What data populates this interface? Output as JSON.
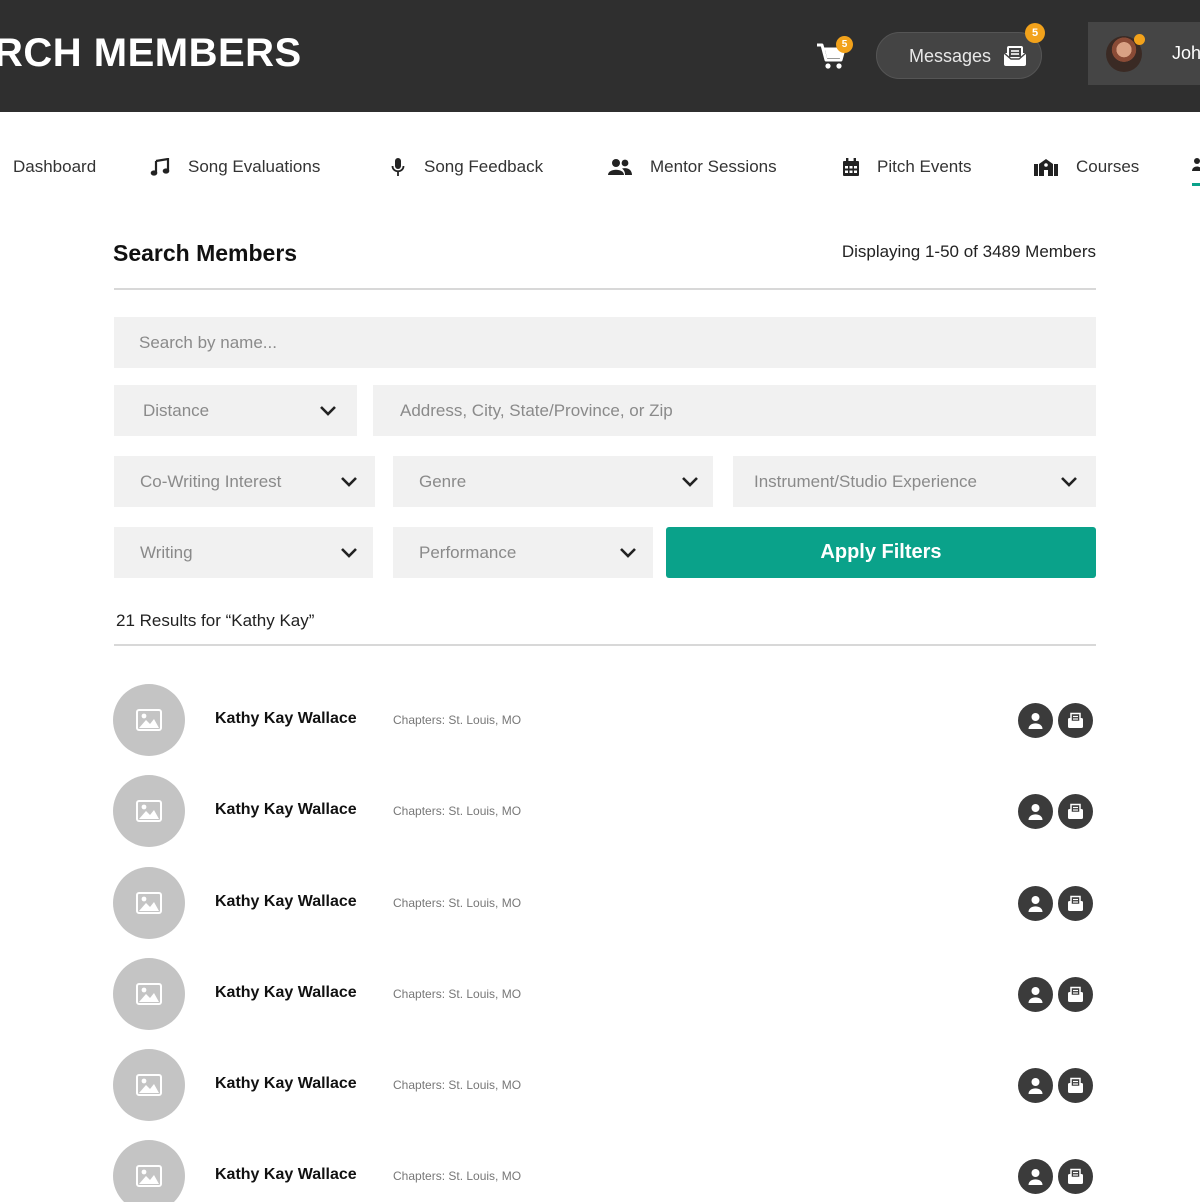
{
  "header": {
    "title": "RCH MEMBERS",
    "cart_count": "5",
    "messages_label": "Messages",
    "messages_count": "5",
    "user_name": "Joh"
  },
  "nav": {
    "items": [
      {
        "label": "Dashboard",
        "icon": "dashboard"
      },
      {
        "label": "Song Evaluations",
        "icon": "music-note-icon"
      },
      {
        "label": "Song Feedback",
        "icon": "microphone-icon"
      },
      {
        "label": "Mentor Sessions",
        "icon": "users-icon"
      },
      {
        "label": "Pitch Events",
        "icon": "calendar-icon"
      },
      {
        "label": "Courses",
        "icon": "school-icon"
      }
    ]
  },
  "main": {
    "title": "Search Members",
    "displaying": "Displaying 1-50 of 3489 Members",
    "search_placeholder": "Search by name...",
    "distance_label": "Distance",
    "address_placeholder": "Address, City, State/Province, or Zip",
    "filters": {
      "cowriting": "Co-Writing Interest",
      "genre": "Genre",
      "instrument": "Instrument/Studio Experience",
      "writing": "Writing",
      "performance": "Performance"
    },
    "apply_label": "Apply Filters",
    "results_text": "21 Results for “Kathy Kay”"
  },
  "members": [
    {
      "name": "Kathy Kay Wallace",
      "chapter": "Chapters: St. Louis, MO"
    },
    {
      "name": "Kathy Kay Wallace",
      "chapter": "Chapters: St. Louis, MO"
    },
    {
      "name": "Kathy Kay Wallace",
      "chapter": "Chapters: St. Louis, MO"
    },
    {
      "name": "Kathy Kay Wallace",
      "chapter": "Chapters: St. Louis, MO"
    },
    {
      "name": "Kathy Kay Wallace",
      "chapter": "Chapters: St. Louis, MO"
    },
    {
      "name": "Kathy Kay Wallace",
      "chapter": "Chapters: St. Louis, MO"
    }
  ],
  "colors": {
    "header_bg": "#2f2f2f",
    "accent": "#0aa28a",
    "badge": "#f2a21b"
  }
}
